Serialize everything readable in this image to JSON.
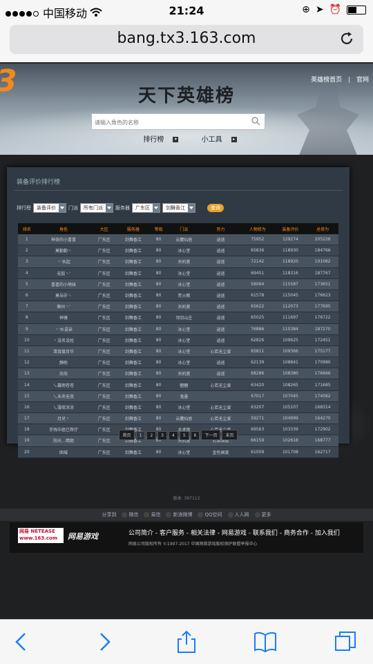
{
  "status_bar": {
    "carrier": "中国移动",
    "time": "21:24"
  },
  "browser": {
    "url": "bang.tx3.163.com"
  },
  "header": {
    "logo": "3",
    "title": "天下英雄榜",
    "links": [
      "英雄榜首页",
      "官网"
    ],
    "search_placeholder": "请输入角色的名称",
    "nav": [
      "排行榜",
      "小工具"
    ]
  },
  "panel": {
    "title": "装备评价排行榜",
    "filters": {
      "rank_label": "排行榜",
      "rank_value": "装备评价",
      "school_label": "门派",
      "school_value": "所有门派",
      "server_label": "服务器",
      "region_value": "广东区",
      "server_value": "剑舞香江",
      "query_label": "查询"
    },
    "columns": [
      "排名",
      "角色",
      "大区",
      "服务器",
      "等级",
      "门派",
      "势力",
      "人物修为",
      "装备评价",
      "总修为"
    ],
    "rows": [
      [
        "1",
        "神奇的小喜喜",
        "广东区",
        "剑舞香江",
        "80",
        "云麓仙居",
        "逍遥",
        "75952",
        "129274",
        "205226"
      ],
      [
        "2",
        "莫勤勤丶",
        "广东区",
        "剑舞香江",
        "80",
        "冰心堂",
        "逍遥",
        "65836",
        "118930",
        "184766"
      ],
      [
        "3",
        "丶'水起",
        "广东区",
        "剑舞香江",
        "80",
        "天机营",
        "逍遥",
        "72142",
        "118920",
        "191062"
      ],
      [
        "4",
        "无敌丶'",
        "广东区",
        "剑舞香江",
        "80",
        "冰心堂",
        "逍遥",
        "69451",
        "118316",
        "187767"
      ],
      [
        "5",
        "喜喜的小萌妹",
        "广东区",
        "剑舞香江",
        "80",
        "冰心堂",
        "逍遥",
        "58064",
        "115587",
        "173651"
      ],
      [
        "6",
        "莫朵矽丶",
        "广东区",
        "剑舞香江",
        "80",
        "荒火教",
        "逍遥",
        "61578",
        "115045",
        "176623"
      ],
      [
        "7",
        "樂州丶'",
        "广东区",
        "剑舞香江",
        "80",
        "天机营",
        "逍遥",
        "65622",
        "112073",
        "177695"
      ],
      [
        "8",
        "神锤",
        "广东区",
        "剑舞香江",
        "80",
        "翎羽山庄",
        "逍遥",
        "65025",
        "111697",
        "176722"
      ],
      [
        "9",
        "丶'水语弟",
        "广东区",
        "剑舞香江",
        "80",
        "冰心堂",
        "逍遥",
        "76886",
        "110384",
        "187270"
      ],
      [
        "10",
        "丶没名没姓",
        "广东区",
        "剑舞香江",
        "80",
        "冰心堂",
        "逍遥",
        "62826",
        "109625",
        "172451"
      ],
      [
        "11",
        "清宵度月华",
        "广东区",
        "剑舞香江",
        "80",
        "冰心堂",
        "心若无尘爱",
        "65811",
        "109366",
        "175177"
      ],
      [
        "12",
        "静盼",
        "广东区",
        "剑舞香江",
        "80",
        "冰心堂",
        "逍遥",
        "62139",
        "108841",
        "170980"
      ],
      [
        "13",
        "尚尚",
        "广东区",
        "剑舞香江",
        "80",
        "天机营",
        "逍遥",
        "68286",
        "108380",
        "176666"
      ],
      [
        "14",
        "乀暮雨苍苍",
        "广东区",
        "剑舞香江",
        "80",
        "魍魉",
        "心若无尘爱",
        "63420",
        "108265",
        "171685"
      ],
      [
        "15",
        "乀未央无双",
        "广东区",
        "剑舞香江",
        "80",
        "鬼墨",
        "",
        "67017",
        "107045",
        "174062"
      ],
      [
        "16",
        "乀薄荷凉凉",
        "广东区",
        "剑舞香江",
        "80",
        "冰心堂",
        "心若无尘爱",
        "63207",
        "105107",
        "168314"
      ],
      [
        "17",
        "月兒丶",
        "广东区",
        "剑舞香江",
        "80",
        "云麓仙居",
        "心若无尘爱",
        "59271",
        "104999",
        "164270"
      ],
      [
        "18",
        "手残中癌已荐疗",
        "广东区",
        "剑舞香江",
        "80",
        "太虚观",
        "心若无尘爱",
        "69563",
        "103339",
        "172902"
      ],
      [
        "19",
        "阳光...晴朗",
        "广东区",
        "剑舞香江",
        "80",
        "天机营",
        "对酒当歌",
        "66159",
        "102618",
        "168777"
      ],
      [
        "20",
        "困城",
        "广东区",
        "剑舞香江",
        "80",
        "冰心堂",
        "金色国度",
        "61009",
        "101708",
        "162717"
      ]
    ],
    "pager": [
      "首页",
      "1",
      "2",
      "3",
      "4",
      "5",
      "6",
      "下一页",
      "末页"
    ]
  },
  "footer": {
    "version": "版本: 397112",
    "share_label": "分享到",
    "share": [
      "微信",
      "易信",
      "新浪微博",
      "QQ空间",
      "人人网",
      "更多"
    ],
    "logo_text": "网易 NETEASE www.163.com",
    "game_logo": "网易游戏",
    "links": "公司简介 - 客户服务 - 相关法律 - 网易游戏 - 联系我们 - 商务合作 - 加入我们",
    "copyright": "网易公司版权所有 ©1997-2017     中国网络游戏版权保护联盟举报中心"
  },
  "colors": {
    "accent": "#f08a20",
    "panel_bg": "#303a45",
    "row_odd": "#485360",
    "row_even": "#3c4652"
  }
}
